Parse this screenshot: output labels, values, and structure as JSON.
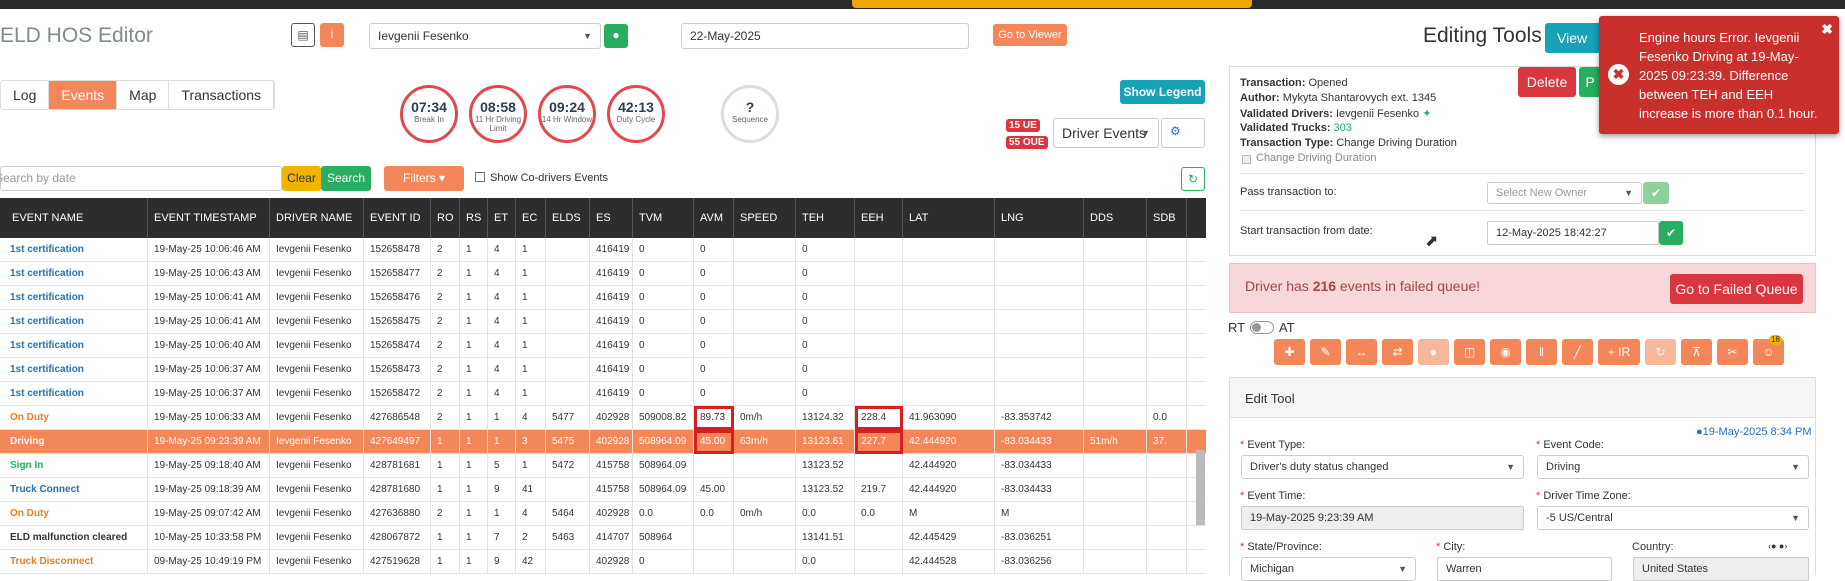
{
  "app": {
    "title": "ELD HOS Editor"
  },
  "header": {
    "driver": "Ievgenii Fesenko",
    "date": "22-May-2025",
    "viewer_btn": "Go to Viewer"
  },
  "tabs": [
    {
      "label": "Log"
    },
    {
      "label": "Events"
    },
    {
      "label": "Map"
    },
    {
      "label": "Transactions"
    }
  ],
  "gauges": [
    {
      "value": "07:34",
      "label": "Break In"
    },
    {
      "value": "08:58",
      "label": "11 Hr Driving Limit"
    },
    {
      "value": "09:24",
      "label": "14 Hr Window"
    },
    {
      "value": "42:13",
      "label": "Duty Cycle"
    },
    {
      "value": "?",
      "label": "Sequence"
    }
  ],
  "legend_btn": "Show Legend",
  "badges": {
    "ue": "15 UE",
    "oue": "55 OUE"
  },
  "driver_events": "Driver Events",
  "search": {
    "placeholder": "Search by date",
    "clear": "Clear",
    "search": "Search",
    "filters": "Filters",
    "codrivers": "Show Co-drivers Events"
  },
  "columns": [
    "EVENT NAME",
    "EVENT TIMESTAMP",
    "DRIVER NAME",
    "EVENT ID",
    "RO",
    "RS",
    "ET",
    "EC",
    "ELDS",
    "ES",
    "TVM",
    "AVM",
    "SPEED",
    "TEH",
    "EEH",
    "LAT",
    "LNG",
    "DDS",
    "SDB"
  ],
  "rows": [
    [
      "1st certification",
      "19-May-25 10:06:46 AM",
      "Ievgenii Fesenko",
      "152658478",
      "2",
      "1",
      "4",
      "1",
      "",
      "416419",
      "0",
      "0",
      "",
      "0",
      "",
      "",
      "",
      "",
      ""
    ],
    [
      "1st certification",
      "19-May-25 10:06:43 AM",
      "Ievgenii Fesenko",
      "152658477",
      "2",
      "1",
      "4",
      "1",
      "",
      "416419",
      "0",
      "0",
      "",
      "0",
      "",
      "",
      "",
      "",
      ""
    ],
    [
      "1st certification",
      "19-May-25 10:06:41 AM",
      "Ievgenii Fesenko",
      "152658476",
      "2",
      "1",
      "4",
      "1",
      "",
      "416419",
      "0",
      "0",
      "",
      "0",
      "",
      "",
      "",
      "",
      ""
    ],
    [
      "1st certification",
      "19-May-25 10:06:41 AM",
      "Ievgenii Fesenko",
      "152658475",
      "2",
      "1",
      "4",
      "1",
      "",
      "416419",
      "0",
      "0",
      "",
      "0",
      "",
      "",
      "",
      "",
      ""
    ],
    [
      "1st certification",
      "19-May-25 10:06:40 AM",
      "Ievgenii Fesenko",
      "152658474",
      "2",
      "1",
      "4",
      "1",
      "",
      "416419",
      "0",
      "0",
      "",
      "0",
      "",
      "",
      "",
      "",
      ""
    ],
    [
      "1st certification",
      "19-May-25 10:06:37 AM",
      "Ievgenii Fesenko",
      "152658473",
      "2",
      "1",
      "4",
      "1",
      "",
      "416419",
      "0",
      "0",
      "",
      "0",
      "",
      "",
      "",
      "",
      ""
    ],
    [
      "1st certification",
      "19-May-25 10:06:37 AM",
      "Ievgenii Fesenko",
      "152658472",
      "2",
      "1",
      "4",
      "1",
      "",
      "416419",
      "0",
      "0",
      "",
      "0",
      "",
      "",
      "",
      "",
      ""
    ],
    [
      "On Duty",
      "19-May-25 10:06:33 AM",
      "Ievgenii Fesenko",
      "427686548",
      "2",
      "1",
      "1",
      "4",
      "5477",
      "402928",
      "509008.82",
      "89.73",
      "0m/h",
      "13124.32",
      "228.4",
      "41.963090",
      "-83.353742",
      "",
      "0.0"
    ],
    [
      "Driving",
      "19-May-25 09:23:39 AM",
      "Ievgenii Fesenko",
      "427649497",
      "1",
      "1",
      "1",
      "3",
      "5475",
      "402928",
      "508964.09",
      "45.00",
      "63m/h",
      "13123.61",
      "227.7",
      "42.444920",
      "-83.034433",
      "51m/h",
      "37."
    ],
    [
      "Sign In",
      "19-May-25 09:18:40 AM",
      "Ievgenii Fesenko",
      "428781681",
      "1",
      "1",
      "5",
      "1",
      "5472",
      "415758",
      "508964.09",
      "",
      "",
      "13123.52",
      "",
      "42.444920",
      "-83.034433",
      "",
      ""
    ],
    [
      "Truck Connect",
      "19-May-25 09:18:39 AM",
      "Ievgenii Fesenko",
      "428781680",
      "1",
      "1",
      "9",
      "41",
      "",
      "415758",
      "508964.09",
      "45.00",
      "",
      "13123.52",
      "219.7",
      "42.444920",
      "-83.034433",
      "",
      ""
    ],
    [
      "On Duty",
      "19-May-25 09:07:42 AM",
      "Ievgenii Fesenko",
      "427636880",
      "2",
      "1",
      "1",
      "4",
      "5464",
      "402928",
      "0.0",
      "0.0",
      "0m/h",
      "0.0",
      "0.0",
      "M",
      "M",
      "",
      ""
    ],
    [
      "ELD malfunction cleared",
      "10-May-25 10:33:58 PM",
      "Ievgenii Fesenko",
      "428067872",
      "1",
      "1",
      "7",
      "2",
      "5463",
      "414707",
      "508964",
      "",
      "",
      "13141.51",
      "",
      "42.445429",
      "-83.036251",
      "",
      ""
    ],
    [
      "Truck Disconnect",
      "09-May-25 10:49:19 PM",
      "Ievgenii Fesenko",
      "427519628",
      "1",
      "1",
      "9",
      "42",
      "",
      "402928",
      "0",
      "",
      "",
      "0.0",
      "",
      "42.444528",
      "-83.036256",
      "",
      ""
    ]
  ],
  "editing": {
    "title": "Editing Tools",
    "view_btn": "View Ev"
  },
  "transaction": {
    "status_label": "Transaction:",
    "status": "Opened",
    "author_label": "Author:",
    "author": "Mykyta Shantarovych ext. 1345",
    "vdrivers_label": "Validated Drivers:",
    "vdrivers": "Ievgenii Fesenko",
    "vtrucks_label": "Validated Trucks:",
    "vtrucks": "303",
    "type_label": "Transaction Type:",
    "type": "Change Driving Duration",
    "checkbox": "Change Driving Duration",
    "delete": "Delete",
    "p": "P",
    "pass_label": "Pass transaction to:",
    "pass_placeholder": "Select New Owner",
    "start_label": "Start transaction from date:",
    "start_value": "12-May-2025 18:42:27"
  },
  "failed": {
    "text_pre": "Driver has ",
    "count": "216",
    "text_post": " events in failed queue!",
    "btn": "Go to Failed Queue"
  },
  "toggle": {
    "rt": "RT",
    "at": "AT"
  },
  "toolbar_badge": "18",
  "edit_tool": {
    "title": "Edit Tool",
    "timestamp": "19-May-2025 8:34 PM",
    "event_type_label": "Event Type:",
    "event_type": "Driver's duty status changed",
    "event_code_label": "Event Code:",
    "event_code": "Driving",
    "event_time_label": "Event Time:",
    "event_time": "19-May-2025 9:23:39 AM",
    "tz_label": "Driver Time Zone:",
    "tz": "-5 US/Central",
    "state_label": "State/Province:",
    "state": "Michigan",
    "city_label": "City:",
    "city": "Warren",
    "country_label": "Country:",
    "country": "United States"
  },
  "toast": {
    "message": "Engine hours Error. Ievgenii Fesenko Driving at 19-May-2025 09:23:39. Difference between TEH and EEH increase is more than 0.1 hour."
  }
}
